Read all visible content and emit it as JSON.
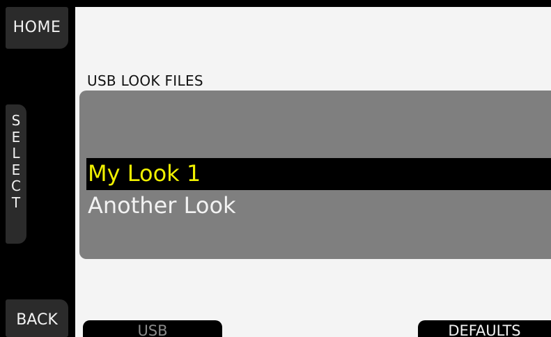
{
  "softkeys": {
    "home": "HOME",
    "select": [
      "S",
      "E",
      "L",
      "E",
      "C",
      "T"
    ],
    "back": "BACK"
  },
  "main": {
    "title": "USB LOOK FILES",
    "items": [
      {
        "label": "My Look 1",
        "selected": true
      },
      {
        "label": "Another Look",
        "selected": false
      }
    ]
  },
  "bottom": {
    "usb": "USB",
    "defaults": "DEFAULTS"
  },
  "colors": {
    "selected_text": "#f0f000",
    "panel": "#7f7f7f",
    "background": "#f4f4f4"
  }
}
